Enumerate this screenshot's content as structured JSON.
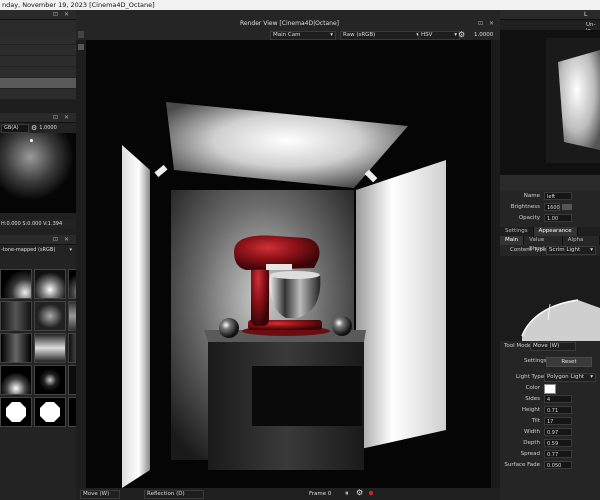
{
  "title_bar": {
    "text": "nday, November 19, 2023  [Cinema4D_Octane]"
  },
  "viewport": {
    "title": "Render View [Cinema4D|Octane]",
    "camera": "Main Cam",
    "color_space": "Raw (sRGB)",
    "mode": "HSV",
    "exposure": "1.0000"
  },
  "left": {
    "hdri_color_space": "GB(A)",
    "hdri_exposure": "1.0000",
    "coords": "H:0.000 S:0.000 V:1.394",
    "tone_mode": "-tone-mapped (sRGB)"
  },
  "right": {
    "header_tab": "Un-lo",
    "light_label": "L",
    "name_label": "Name",
    "name_value": "left",
    "brightness_label": "Brightness",
    "brightness_value": "1600",
    "opacity_label": "Opacity",
    "opacity_value": "1.00",
    "tabs": [
      "Settings",
      "Appearance"
    ],
    "subtabs": [
      "Main",
      "Value Blend",
      "Alpha Multi"
    ],
    "content_type_label": "Content Type",
    "content_type_value": "Scrim Light",
    "tool_mode_label": "Tool Mode",
    "tool_mode_value": "Move (W)",
    "settings_label": "Settings",
    "reset_label": "Reset",
    "light_type_label": "Light Type",
    "light_type_value": "Polygon Light",
    "color_label": "Color",
    "props": [
      {
        "label": "Sides",
        "value": "4"
      },
      {
        "label": "Height",
        "value": "0.71"
      },
      {
        "label": "Tilt",
        "value": "17"
      },
      {
        "label": "Width",
        "value": "0.97"
      },
      {
        "label": "Depth",
        "value": "0.59"
      },
      {
        "label": "Spread",
        "value": "0.77"
      },
      {
        "label": "Surface Fade",
        "value": "0.050"
      }
    ]
  },
  "bottom": {
    "move_mode": "Move (W)",
    "reflection": "Reflection (D)",
    "frame": "Frame 0"
  },
  "colors": {
    "mixer_red": "#8c1218",
    "panel_bg": "#252525",
    "selection": "#5a5a5a"
  }
}
